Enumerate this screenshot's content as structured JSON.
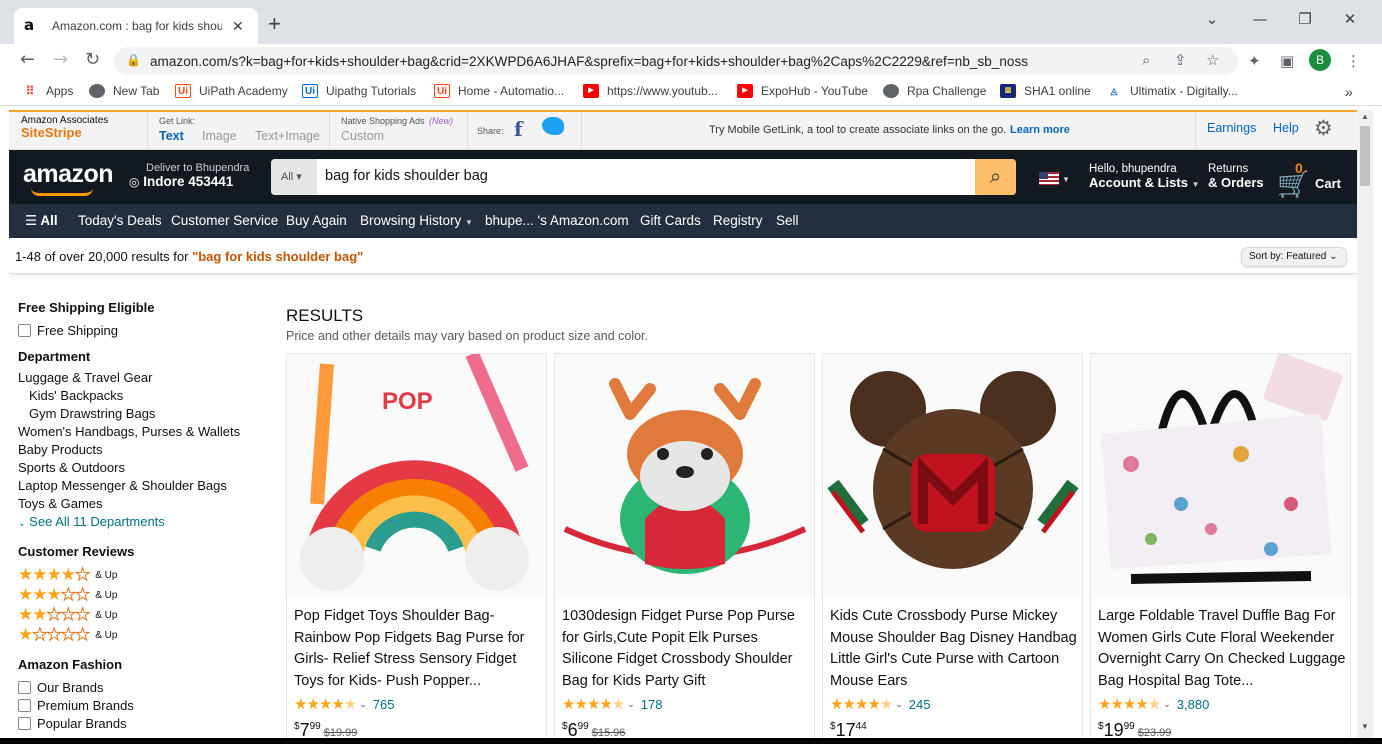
{
  "browser": {
    "tab_title": "Amazon.com : bag for kids should",
    "url": "amazon.com/s?k=bag+for+kids+shoulder+bag&crid=2XKWPD6A6JHAF&sprefix=bag+for+kids+shoulder+bag%2Caps%2C2229&ref=nb_sb_noss",
    "profile_initial": "B",
    "bookmarks": [
      {
        "label": "Apps",
        "icon": "apps-grid-icon"
      },
      {
        "label": "New Tab",
        "icon": "globe-icon"
      },
      {
        "label": "UiPath Academy",
        "icon": "uipath-icon"
      },
      {
        "label": "Uipathg Tutorials",
        "icon": "uipath-icon"
      },
      {
        "label": "Home - Automatio...",
        "icon": "uipath-icon"
      },
      {
        "label": "https://www.youtub...",
        "icon": "youtube-icon"
      },
      {
        "label": "ExpoHub - YouTube",
        "icon": "youtube-icon"
      },
      {
        "label": "Rpa Challenge",
        "icon": "globe-icon"
      },
      {
        "label": "SHA1 online",
        "icon": "sha1-icon"
      },
      {
        "label": "Ultimatix - Digitally...",
        "icon": "tata-icon"
      }
    ]
  },
  "sitestripe": {
    "brand_top": "Amazon Associates",
    "brand_bottom": "SiteStripe",
    "getlink_label": "Get Link:",
    "getlink_text": "Text",
    "getlink_image": "Image",
    "getlink_textimage": "Text+Image",
    "native_label": "Native Shopping Ads",
    "native_new": "(New)",
    "native_custom": "Custom",
    "share_label": "Share:",
    "promo_text": "Try Mobile GetLink, a tool to create associate links on the go.",
    "promo_link": "Learn more",
    "earnings": "Earnings",
    "help": "Help"
  },
  "header": {
    "logo": "amazon",
    "deliver_line1": "Deliver to Bhupendra",
    "deliver_line2": "Indore 453441",
    "search_category": "All",
    "search_query": "bag for kids shoulder bag",
    "account_line1": "Hello, bhupendra",
    "account_line2": "Account & Lists",
    "returns_line1": "Returns",
    "returns_line2": "& Orders",
    "cart_count": "0",
    "cart_label": "Cart"
  },
  "nav": [
    "All",
    "Today's Deals",
    "Customer Service",
    "Buy Again",
    "Browsing History",
    "bhupe... 's Amazon.com",
    "Gift Cards",
    "Registry",
    "Sell"
  ],
  "results_bar": {
    "prefix": "1-48 of over 20,000 results for",
    "query": "\"bag for kids shoulder bag\"",
    "sort_label": "Sort by:",
    "sort_value": "Featured"
  },
  "sidebar": {
    "free_shipping_heading": "Free Shipping Eligible",
    "free_shipping_option": "Free Shipping",
    "department_heading": "Department",
    "departments": [
      "Luggage & Travel Gear",
      "Kids' Backpacks",
      "Gym Drawstring Bags",
      "Women's Handbags, Purses & Wallets",
      "Baby Products",
      "Sports & Outdoors",
      "Laptop Messenger & Shoulder Bags",
      "Toys & Games"
    ],
    "see_all": "See All 11 Departments",
    "reviews_heading": "Customer Reviews",
    "review_rows": [
      {
        "stars": 4,
        "label": "& Up"
      },
      {
        "stars": 3,
        "label": "& Up"
      },
      {
        "stars": 2,
        "label": "& Up"
      },
      {
        "stars": 1,
        "label": "& Up"
      }
    ],
    "fashion_heading": "Amazon Fashion",
    "fashion_options": [
      "Our Brands",
      "Premium Brands",
      "Popular Brands"
    ]
  },
  "results": {
    "heading": "RESULTS",
    "subheading": "Price and other details may vary based on product size and color.",
    "products": [
      {
        "title": "Pop Fidget Toys Shoulder Bag- Rainbow Pop Fidgets Bag Purse for Girls- Relief Stress Sensory Fidget Toys for Kids- Push Popper...",
        "rating": 4.5,
        "reviews": "765",
        "price_whole": "7",
        "price_frac": "99",
        "list_price": "$19.99"
      },
      {
        "title": "1030design Fidget Purse Pop Purse for Girls,Cute Popit Elk Purses Silicone Fidget Crossbody Shoulder Bag for Kids Party Gift",
        "rating": 4.5,
        "reviews": "178",
        "price_whole": "6",
        "price_frac": "99",
        "list_price": "$15.96"
      },
      {
        "title": "Kids Cute Crossbody Purse Mickey Mouse Shoulder Bag Disney Handbag Little Girl's Cute Purse with Cartoon Mouse Ears",
        "rating": 4.5,
        "reviews": "245",
        "price_whole": "17",
        "price_frac": "44",
        "list_price": ""
      },
      {
        "title": "Large Foldable Travel Duffle Bag For Women Girls Cute Floral Weekender Overnight Carry On Checked Luggage Bag Hospital Bag Tote...",
        "rating": 4.5,
        "reviews": "3,880",
        "price_whole": "19",
        "price_frac": "99",
        "list_price": "$23.99"
      }
    ]
  },
  "colors": {
    "navbelt": "#131921",
    "navmain": "#232f3e",
    "accent": "#ff9900",
    "link": "#007185",
    "search_btn": "#febd69",
    "query_highlight": "#c45500"
  }
}
